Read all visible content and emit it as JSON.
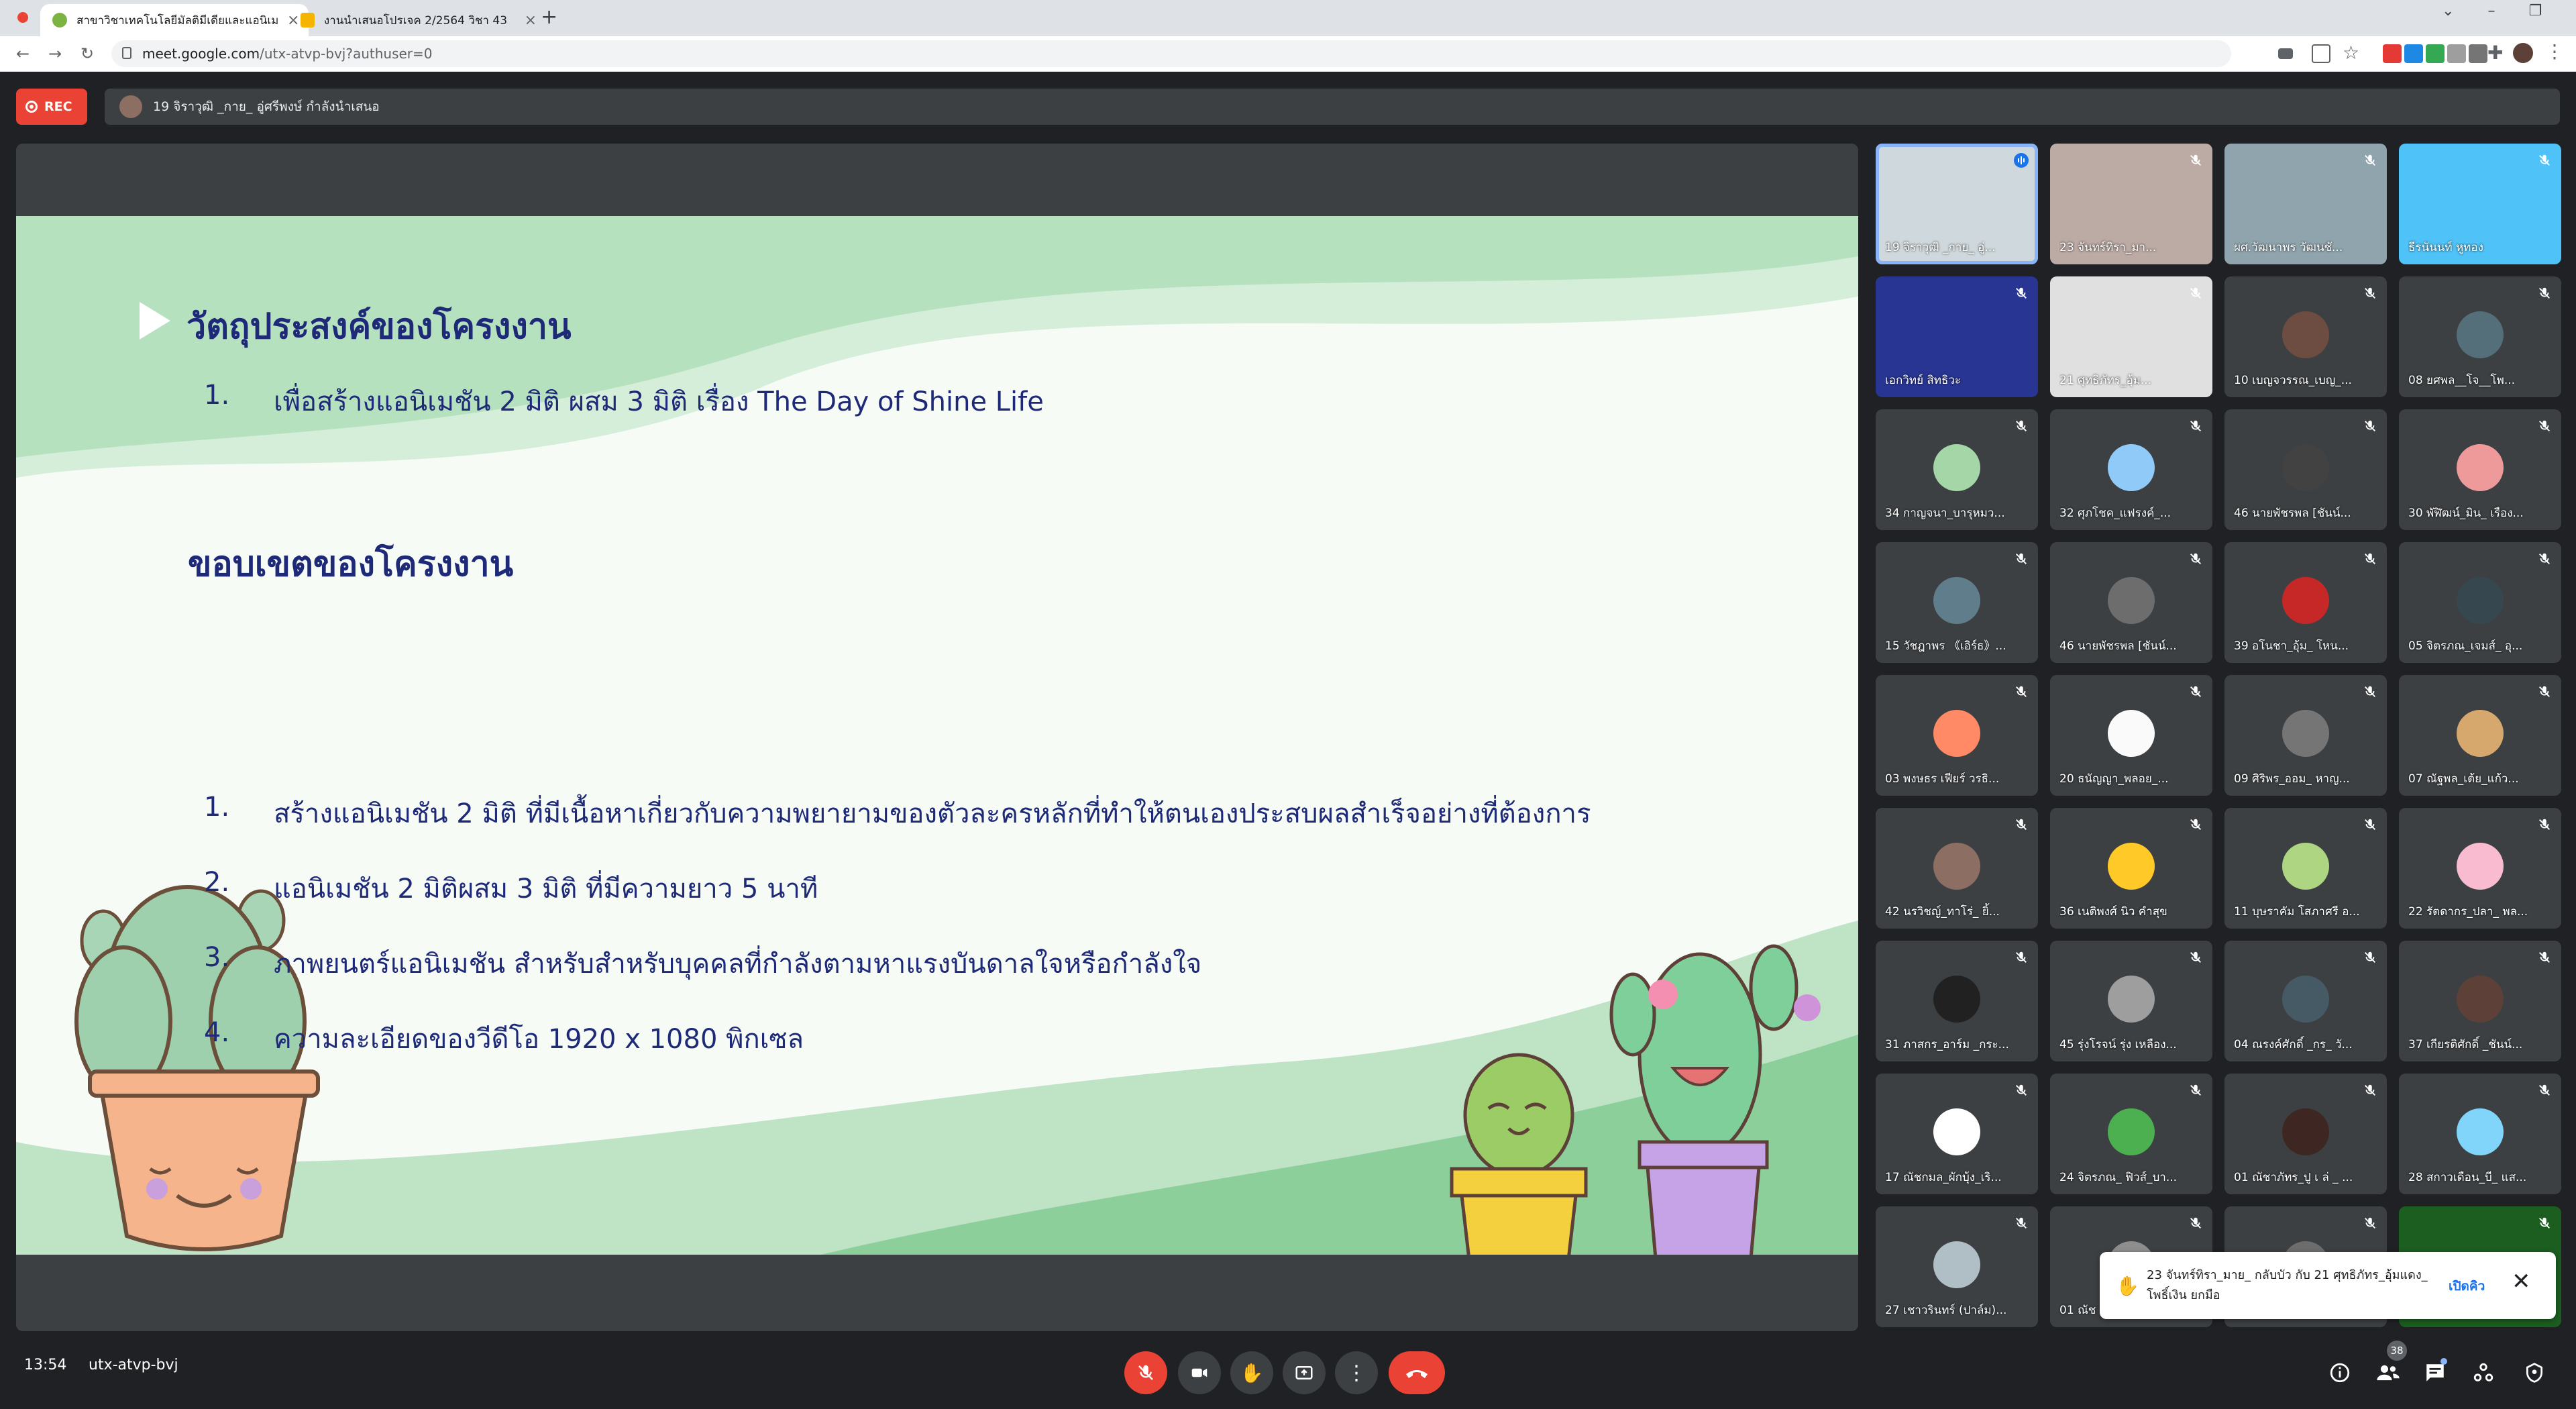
{
  "browser": {
    "tabs": [
      {
        "title": "สาขาวิชาเทคโนโลยีมัลติมีเดียและแอนิเม",
        "active": true
      },
      {
        "title": "งานนำเสนอโปรเจค 2/2564 วิชา 43",
        "active": false
      }
    ],
    "new_tab_label": "+",
    "url_host": "meet.google.com",
    "url_path": "/utx-atvp-bvj?authuser=0"
  },
  "meet": {
    "rec_label": "REC",
    "presenting_text": "19 จิราวุฒิ _กาย_ อู่ศรีพงษ์ กำลังนำเสนอ",
    "clock": "13:54",
    "meeting_code": "utx-atvp-bvj",
    "participant_count": "38"
  },
  "slide": {
    "heading1": "วัตถุประสงค์ของโครงงาน",
    "objective_num": "1.",
    "objective": "เพื่อสร้างแอนิเมชัน 2 มิติ ผสม 3 มิติ เรื่อง The Day of Shine Life",
    "heading2": "ขอบเขตของโครงงาน",
    "scope": [
      {
        "num": "1.",
        "text": "สร้างแอนิเมชัน 2 มิติ ที่มีเนื้อหาเกี่ยวกับความพยายามของตัวละครหลักที่ทำให้ตนเองประสบผลสำเร็จอย่างที่ต้องการ"
      },
      {
        "num": "2.",
        "text": "แอนิเมชัน 2 มิติผสม 3 มิติ ที่มีความยาว 5 นาที"
      },
      {
        "num": "3.",
        "text": "ภาพยนตร์แอนิเมชัน สำหรับสำหรับบุคคลที่กำลังตามหาแรงบันดาลใจหรือกำลังใจ"
      },
      {
        "num": "4.",
        "text": "ความละเอียดของวีดีโอ 1920 x 1080 พิกเซล"
      }
    ]
  },
  "participants": [
    {
      "name": "19 จิราวุฒิ _กาย_ อู่...",
      "color": "#cfd8dc"
    },
    {
      "name": "23 จันทร์ทิรา_มา...",
      "color": "#bcaaa4"
    },
    {
      "name": "ผศ.วัฒนาพร วัฒนชั...",
      "color": "#90a4ae"
    },
    {
      "name": "ธีรนันนท์ หูทอง",
      "color": "#4fc3f7"
    },
    {
      "name": "เอกวิทย์ สิทธิวะ",
      "color": "#283593"
    },
    {
      "name": "21 ศุทธิภัทร_อุ้ม...",
      "color": "#e0e0e0"
    },
    {
      "name": "10 เบญจวรรณ_เบญ_...",
      "color": "#6d4c41"
    },
    {
      "name": "08 ยศพล__โจ__โพ...",
      "color": "#546e7a"
    },
    {
      "name": "34 กาญจนา_บารุหมว...",
      "color": "#a5d6a7"
    },
    {
      "name": "32 ศุภโชค_แฟรงค์_...",
      "color": "#90caf9"
    },
    {
      "name": "46 นายพัชรพล [ชันน์...",
      "color": "#424242"
    },
    {
      "name": "30 พัฬิฒน์_มิน_ เรือง...",
      "color": "#ef9a9a"
    },
    {
      "name": "15 วัชฎาพร 《เอิร์ธ》...",
      "color": "#607d8b"
    },
    {
      "name": "46 นายพัชรพล [ชันน์...",
      "color": "#6d6d6d"
    },
    {
      "name": "39 อโนชา_อุ้ม_ โหน...",
      "color": "#c62828"
    },
    {
      "name": "05 จิตรภณ_เจมส์_ อุ...",
      "color": "#37474f"
    },
    {
      "name": "03 พงษธร เฟียร์ วรธิ...",
      "color": "#ff8a65"
    },
    {
      "name": "20 ธนัญญา_พลอย_...",
      "color": "#fafafa"
    },
    {
      "name": "09 ศิริพร_ออม_ หาญ...",
      "color": "#757575"
    },
    {
      "name": "07 ณัฐพล_เต้ย_แก้ว...",
      "color": "#d7a86e"
    },
    {
      "name": "42 นรวิชญ์_ทาโร่_ ยิ้...",
      "color": "#8d6e63"
    },
    {
      "name": "36 เนติพงศ์ นิว คำสุข",
      "color": "#ffca28"
    },
    {
      "name": "11 บุษราคัม โสภาศรี อ...",
      "color": "#aed581"
    },
    {
      "name": "22 รัตดากร_ปลา_ พล...",
      "color": "#f8bbd0"
    },
    {
      "name": "31 ภาสกร_อาร์ม _กระ...",
      "color": "#212121"
    },
    {
      "name": "45 รุ่งโรจน์ รุ่ง เหลือง...",
      "color": "#9e9e9e"
    },
    {
      "name": "04 ณรงค์ศักดิ์ _กร_ วั...",
      "color": "#455a64"
    },
    {
      "name": "37 เกียรติศักดิ์ _ชันน์...",
      "color": "#5d4037"
    },
    {
      "name": "17 ณัชกมล_ผักบุ้ง_เริ...",
      "color": "#ffffff"
    },
    {
      "name": "24 จิตรภณ_ ฟิวส์_บา...",
      "color": "#4caf50"
    },
    {
      "name": "01 ณัชาภัทร_ปู เ ล่ _ ...",
      "color": "#3e2723"
    },
    {
      "name": "28 สกาวเดือน_บี_ แส...",
      "color": "#81d4fa"
    },
    {
      "name": "27 เชาวรินทร์ (ปาล์ม)...",
      "color": "#b0bec5"
    },
    {
      "name": "01 ณัช",
      "color": "#8e8e8e"
    },
    {
      "name": "",
      "color": "#6d6d6d"
    },
    {
      "name": "",
      "color": "#1b5e20"
    }
  ],
  "toast": {
    "message": "23 จันทร์ทิรา_มาย_ กลับบัว กับ 21 ศุทธิภัทร_อุ้มแดง_ โพธิ์เงิน ยกมือ",
    "action": "เปิดคิว"
  }
}
